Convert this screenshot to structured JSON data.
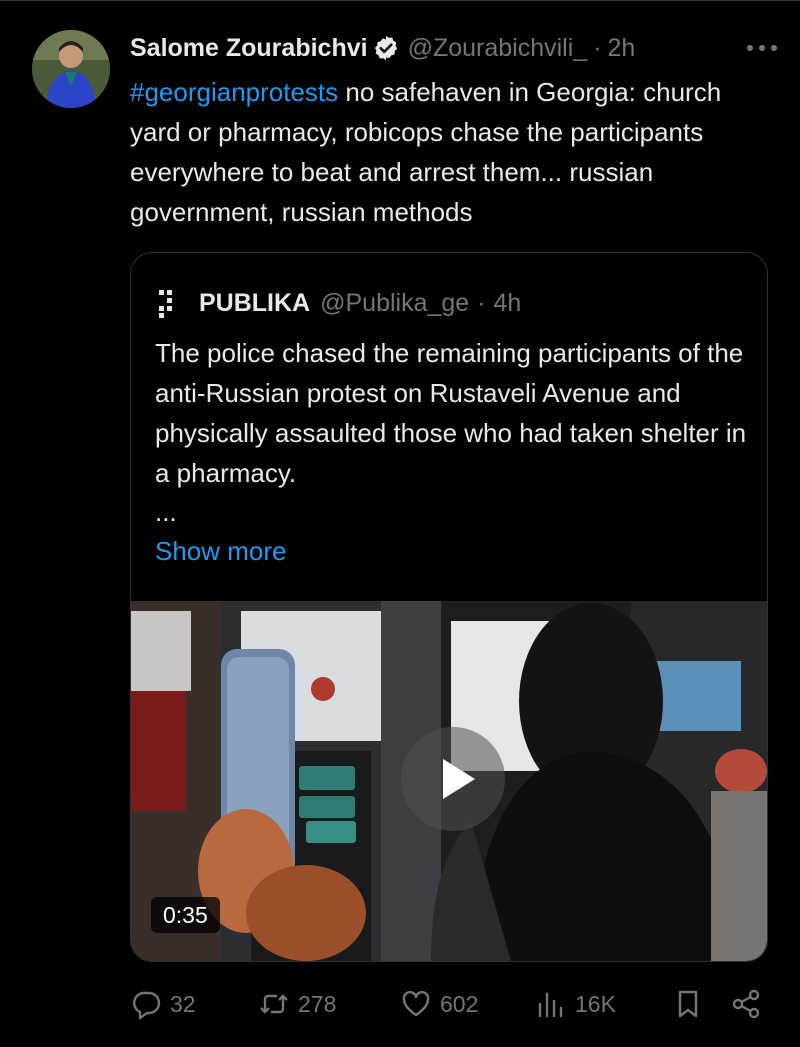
{
  "tweet": {
    "author_name": "Salome Zourabichvi",
    "author_handle": "@Zourabichvili_",
    "separator": "·",
    "time": "2h",
    "hashtag": "#georgianprotests",
    "text_rest": " no safehaven in Georgia: church yard or pharmacy, robicops chase the participants everywhere to beat and arrest them... russian government, russian methods"
  },
  "quote": {
    "author_name": "PUBLIKA",
    "author_handle": "@Publika_ge",
    "separator": "·",
    "time": "4h",
    "text": "The police chased the remaining participants of the anti-Russian protest on Rustaveli Avenue and physically assaulted those who had taken shelter in a pharmacy.",
    "ellipsis": "...",
    "show_more_label": "Show more",
    "video_duration": "0:35"
  },
  "actions": {
    "replies": "32",
    "reposts": "278",
    "likes": "602",
    "views": "16K"
  },
  "colors": {
    "background": "#000000",
    "text": "#e7e9ea",
    "muted": "#71767b",
    "link": "#1d9bf0",
    "border": "#2f3336"
  },
  "icons": {
    "verified": "verified-badge-icon",
    "more": "more-icon",
    "reply": "reply-icon",
    "repost": "repost-icon",
    "like": "heart-icon",
    "views": "views-icon",
    "bookmark": "bookmark-icon",
    "share": "share-icon",
    "play": "play-icon"
  }
}
